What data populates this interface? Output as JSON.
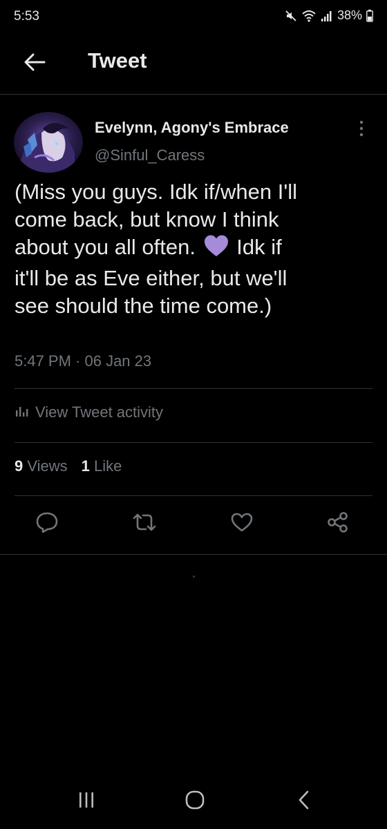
{
  "status_bar": {
    "time": "5:53",
    "battery": "38%",
    "icons": [
      "mute-icon",
      "wifi-icon",
      "signal-icon",
      "battery-icon"
    ]
  },
  "header": {
    "title": "Tweet",
    "back_icon": "arrow-left-icon"
  },
  "tweet": {
    "author_name": "Evelynn, Agony's Embrace",
    "author_handle": "@Sinful_Caress",
    "text_lines": [
      "(Miss you guys. Idk if/when I'll",
      "come back, but know I think",
      "about you all often.",
      "Idk if",
      "it'll be as Eve either, but we'll",
      "see should the time come.)"
    ],
    "emoji": "purple-heart",
    "timestamp": "5:47 PM · 06 Jan 23",
    "activity_label": "View Tweet activity",
    "views_count": "9",
    "views_label": "Views",
    "likes_count": "1",
    "likes_label": "Like"
  },
  "actions": [
    "reply-icon",
    "retweet-icon",
    "like-icon",
    "share-icon"
  ],
  "nav_bar": [
    "recents-icon",
    "home-icon",
    "back-icon"
  ],
  "colors": {
    "background": "#000000",
    "text_primary": "#e7e9ea",
    "text_secondary": "#71767b",
    "divider": "#2f3336",
    "heart_emoji": "#a78bdb"
  }
}
